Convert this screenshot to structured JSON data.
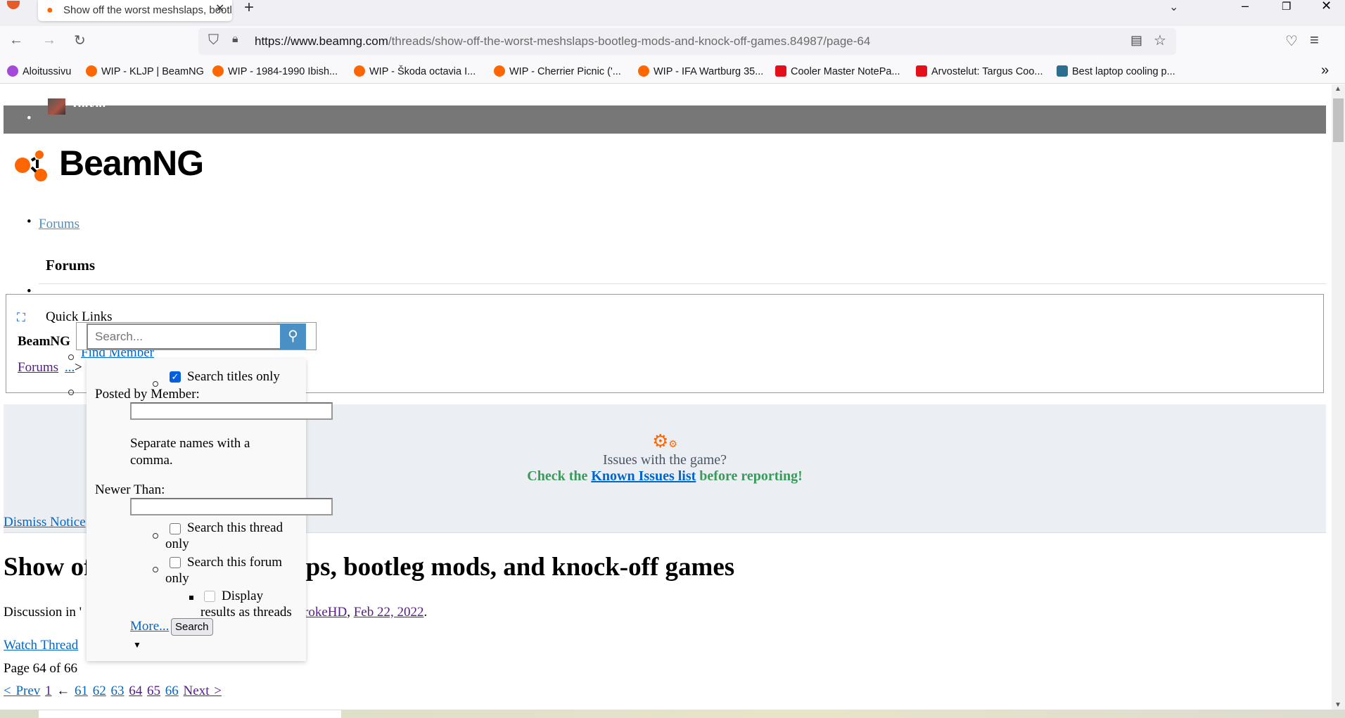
{
  "browser": {
    "tab_title": "Show off the worst meshslaps, bootleg mods, and knock-off games",
    "url_host": "https://www.beamng.com",
    "url_path": "/threads/show-off-the-worst-meshslaps-bootleg-mods-and-knock-off-games.84987/page-64",
    "bookmarks": [
      "Aloitussivu",
      "WIP - KLJP | BeamNG",
      "WIP - 1984-1990 Ibish...",
      "WIP - Škoda octavia I...",
      "WIP - Cherrier Picnic ('...",
      "WIP - IFA Wartburg 35...",
      "Cooler Master NotePa...",
      "Arvostelut: Targus Coo...",
      "Best laptop cooling p..."
    ]
  },
  "user": {
    "name": "Toivio"
  },
  "logo": "BeamNG",
  "nav": {
    "forums_link": "Forums",
    "forums_heading": "Forums",
    "quick_links": "Quick Links",
    "site": "BeamNG",
    "find_member": "Find Member",
    "breadcrumb_forums": "Forums",
    "breadcrumb_more": "...",
    "breadcrumb_sep": ">"
  },
  "search": {
    "placeholder": "Search...",
    "titles_only": "Search titles only",
    "posted_by": "Posted by Member:",
    "separate_hint": "Separate names with a comma.",
    "newer_than": "Newer Than:",
    "this_thread": "Search this thread",
    "this_forum": "Search this forum",
    "only": "only",
    "display": "Display",
    "results_as_threads": "results as threads",
    "more": "More...",
    "button": "Search"
  },
  "notice": {
    "question": "Issues with the game?",
    "check": "Check the",
    "link": "Known Issues list",
    "after": "before reporting!",
    "dismiss": "Dismiss Notice"
  },
  "thread": {
    "title": "Show off the worst meshslaps, bootleg mods, and knock-off games",
    "discussion_in": "Discussion in '",
    "author_partial": "rokeHD",
    "date": "Feb 22, 2022",
    "watch": "Watch Thread",
    "page_info": "Page 64 of 66"
  },
  "pagination": {
    "prev": "< Prev",
    "first": "1",
    "arrow": "←",
    "pages": [
      "61",
      "62",
      "63",
      "64",
      "65",
      "66"
    ],
    "next": "Next >"
  },
  "colors": {
    "accent": "#ff6600",
    "search_btn": "#4a90c4",
    "notice_bg": "#ebeff3",
    "green": "#3a9a5a"
  }
}
